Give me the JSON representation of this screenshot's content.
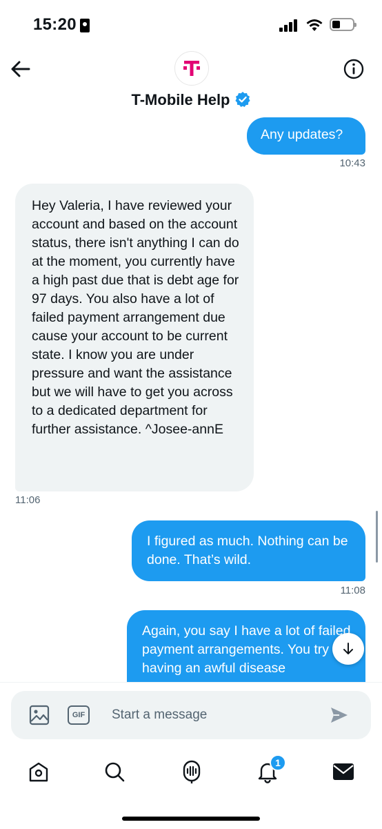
{
  "status_bar": {
    "time": "15:20"
  },
  "header": {
    "title": "T-Mobile Help",
    "logo_letter": "T"
  },
  "messages": [
    {
      "text": "Any updates?",
      "time": "10:43"
    },
    {
      "text": "Hey Valeria, I have reviewed your account and based on the account status, there isn't anything I can do at the moment, you currently have a high past due that is debt age for 97 days. You also have a lot of failed payment arrangement due cause your account to be current state. I know you are under pressure  and want the assistance but we will have to get you across to a dedicated department for further assistance. ^Josee-annE",
      "time": "11:06"
    },
    {
      "text": "I figured as much. Nothing can be done. That’s wild.",
      "time": "11:08"
    },
    {
      "text": "Again, you say I have a lot of failed payment arrangements. You try having an awful disease"
    }
  ],
  "composer": {
    "placeholder": "Start a message",
    "gif_label": "GIF"
  },
  "tabbar": {
    "notifications_badge": "1"
  },
  "colors": {
    "accent": "#1d9bf0",
    "brand": "#e20074",
    "received_bg": "#eff3f4"
  }
}
